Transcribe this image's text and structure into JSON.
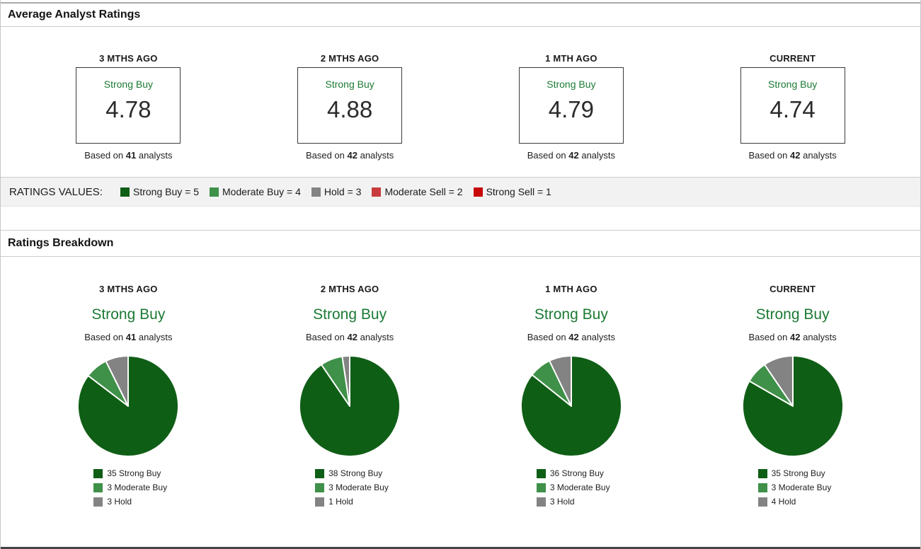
{
  "average_panel": {
    "title": "Average Analyst Ratings",
    "columns": [
      {
        "period": "3 MTHS AGO",
        "rating": "Strong Buy",
        "value": "4.78",
        "based_prefix": "Based on",
        "analysts": "41",
        "based_suffix": "analysts"
      },
      {
        "period": "2 MTHS AGO",
        "rating": "Strong Buy",
        "value": "4.88",
        "based_prefix": "Based on",
        "analysts": "42",
        "based_suffix": "analysts"
      },
      {
        "period": "1 MTH AGO",
        "rating": "Strong Buy",
        "value": "4.79",
        "based_prefix": "Based on",
        "analysts": "42",
        "based_suffix": "analysts"
      },
      {
        "period": "CURRENT",
        "rating": "Strong Buy",
        "value": "4.74",
        "based_prefix": "Based on",
        "analysts": "42",
        "based_suffix": "analysts"
      }
    ]
  },
  "ratings_values": {
    "label": "RATINGS VALUES:",
    "items": [
      {
        "label": "Strong Buy = 5",
        "color": "#0f5e16"
      },
      {
        "label": "Moderate Buy = 4",
        "color": "#3f9048"
      },
      {
        "label": "Hold = 3",
        "color": "#838383"
      },
      {
        "label": "Moderate Sell = 2",
        "color": "#c83c3e"
      },
      {
        "label": "Strong Sell = 1",
        "color": "#c80808"
      }
    ]
  },
  "breakdown_panel": {
    "title": "Ratings Breakdown",
    "columns": [
      {
        "period": "3 MTHS AGO",
        "rating": "Strong Buy",
        "based_prefix": "Based on",
        "analysts": "41",
        "based_suffix": "analysts"
      },
      {
        "period": "2 MTHS AGO",
        "rating": "Strong Buy",
        "based_prefix": "Based on",
        "analysts": "42",
        "based_suffix": "analysts"
      },
      {
        "period": "1 MTH AGO",
        "rating": "Strong Buy",
        "based_prefix": "Based on",
        "analysts": "42",
        "based_suffix": "analysts"
      },
      {
        "period": "CURRENT",
        "rating": "Strong Buy",
        "based_prefix": "Based on",
        "analysts": "42",
        "based_suffix": "analysts"
      }
    ]
  },
  "chart_data": [
    {
      "type": "pie",
      "period": "3 MTHS AGO",
      "consensus": "Strong Buy",
      "total_analysts": 41,
      "labels": [
        "Strong Buy",
        "Moderate Buy",
        "Hold"
      ],
      "values": [
        35,
        3,
        3
      ],
      "colors": [
        "#0f5e16",
        "#3f9048",
        "#838383"
      ],
      "legend": [
        "35 Strong Buy",
        "3 Moderate Buy",
        "3 Hold"
      ],
      "start_angle": "12 o'clock",
      "direction": "clockwise"
    },
    {
      "type": "pie",
      "period": "2 MTHS AGO",
      "consensus": "Strong Buy",
      "total_analysts": 42,
      "labels": [
        "Strong Buy",
        "Moderate Buy",
        "Hold"
      ],
      "values": [
        38,
        3,
        1
      ],
      "colors": [
        "#0f5e16",
        "#3f9048",
        "#838383"
      ],
      "legend": [
        "38 Strong Buy",
        "3 Moderate Buy",
        "1 Hold"
      ],
      "start_angle": "12 o'clock",
      "direction": "clockwise"
    },
    {
      "type": "pie",
      "period": "1 MTH AGO",
      "consensus": "Strong Buy",
      "total_analysts": 42,
      "labels": [
        "Strong Buy",
        "Moderate Buy",
        "Hold"
      ],
      "values": [
        36,
        3,
        3
      ],
      "colors": [
        "#0f5e16",
        "#3f9048",
        "#838383"
      ],
      "legend": [
        "36 Strong Buy",
        "3 Moderate Buy",
        "3 Hold"
      ],
      "start_angle": "12 o'clock",
      "direction": "clockwise"
    },
    {
      "type": "pie",
      "period": "CURRENT",
      "consensus": "Strong Buy",
      "total_analysts": 42,
      "labels": [
        "Strong Buy",
        "Moderate Buy",
        "Hold"
      ],
      "values": [
        35,
        3,
        4
      ],
      "colors": [
        "#0f5e16",
        "#3f9048",
        "#838383"
      ],
      "legend": [
        "35 Strong Buy",
        "3 Moderate Buy",
        "4 Hold"
      ],
      "start_angle": "12 o'clock",
      "direction": "clockwise"
    }
  ],
  "colors": {
    "strong_buy": "#0f5e16",
    "moderate_buy": "#3f9048",
    "hold": "#838383",
    "moderate_sell": "#c83c3e",
    "strong_sell": "#c80808",
    "consensus_text": "#1b7a34"
  }
}
